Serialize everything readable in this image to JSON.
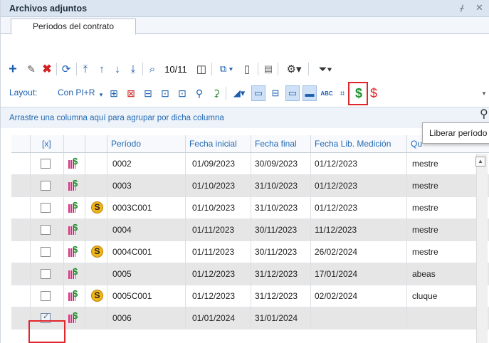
{
  "panel": {
    "title": "Archivos adjuntos",
    "pin_glyph": "ᚋ",
    "close_glyph": "✕"
  },
  "tabs": [
    {
      "label": "Períodos del contrato",
      "active": true
    }
  ],
  "toolbar": {
    "record_counter": "10/11",
    "icons": [
      "add-icon",
      "edit-icon",
      "delete-icon",
      "refresh-icon",
      "move-first-icon",
      "move-up-icon",
      "move-down-icon",
      "move-last-icon",
      "search-icon",
      "columns-icon",
      "export-icon",
      "document-icon",
      "report-icon",
      "settings-icon",
      "filter-icon"
    ]
  },
  "layout_bar": {
    "label": "Layout:",
    "value": "Con PI+R",
    "highlighted_button": "liberar-periodo-button"
  },
  "group_hint": "Arrastre una columna aquí para agrupar por dicha columna",
  "tooltip": "Liberar período",
  "grid": {
    "columns": {
      "check": "[x]",
      "periodo": "Período",
      "fecha_inicial": "Fecha inicial",
      "fecha_final": "Fecha final",
      "fecha_lib": "Fecha Lib. Medición",
      "quien": "Qu"
    },
    "rows": [
      {
        "checked": false,
        "coin": false,
        "periodo": "0002",
        "fecha_inicial": "01/09/2023",
        "fecha_final": "30/09/2023",
        "fecha_lib": "01/12/2023",
        "quien": "mestre"
      },
      {
        "checked": false,
        "coin": false,
        "periodo": "0003",
        "fecha_inicial": "01/10/2023",
        "fecha_final": "31/10/2023",
        "fecha_lib": "01/12/2023",
        "quien": "mestre"
      },
      {
        "checked": false,
        "coin": true,
        "periodo": "0003C001",
        "fecha_inicial": "01/10/2023",
        "fecha_final": "31/10/2023",
        "fecha_lib": "01/12/2023",
        "quien": "mestre"
      },
      {
        "checked": false,
        "coin": false,
        "periodo": "0004",
        "fecha_inicial": "01/11/2023",
        "fecha_final": "30/11/2023",
        "fecha_lib": "11/12/2023",
        "quien": "mestre"
      },
      {
        "checked": false,
        "coin": true,
        "periodo": "0004C001",
        "fecha_inicial": "01/11/2023",
        "fecha_final": "30/11/2023",
        "fecha_lib": "26/02/2024",
        "quien": "mestre"
      },
      {
        "checked": false,
        "coin": false,
        "periodo": "0005",
        "fecha_inicial": "01/12/2023",
        "fecha_final": "31/12/2023",
        "fecha_lib": "17/01/2024",
        "quien": "abeas"
      },
      {
        "checked": false,
        "coin": true,
        "periodo": "0005C001",
        "fecha_inicial": "01/12/2023",
        "fecha_final": "31/12/2023",
        "fecha_lib": "02/02/2024",
        "quien": "cluque"
      },
      {
        "checked": true,
        "coin": false,
        "periodo": "0006",
        "fecha_inicial": "01/01/2024",
        "fecha_final": "31/01/2024",
        "fecha_lib": "",
        "quien": ""
      }
    ]
  },
  "colors": {
    "accent": "#1c5fae",
    "highlight_box": "#e0262b",
    "row_alt": "#e6e6e6",
    "money_green": "#1f8f2f"
  }
}
